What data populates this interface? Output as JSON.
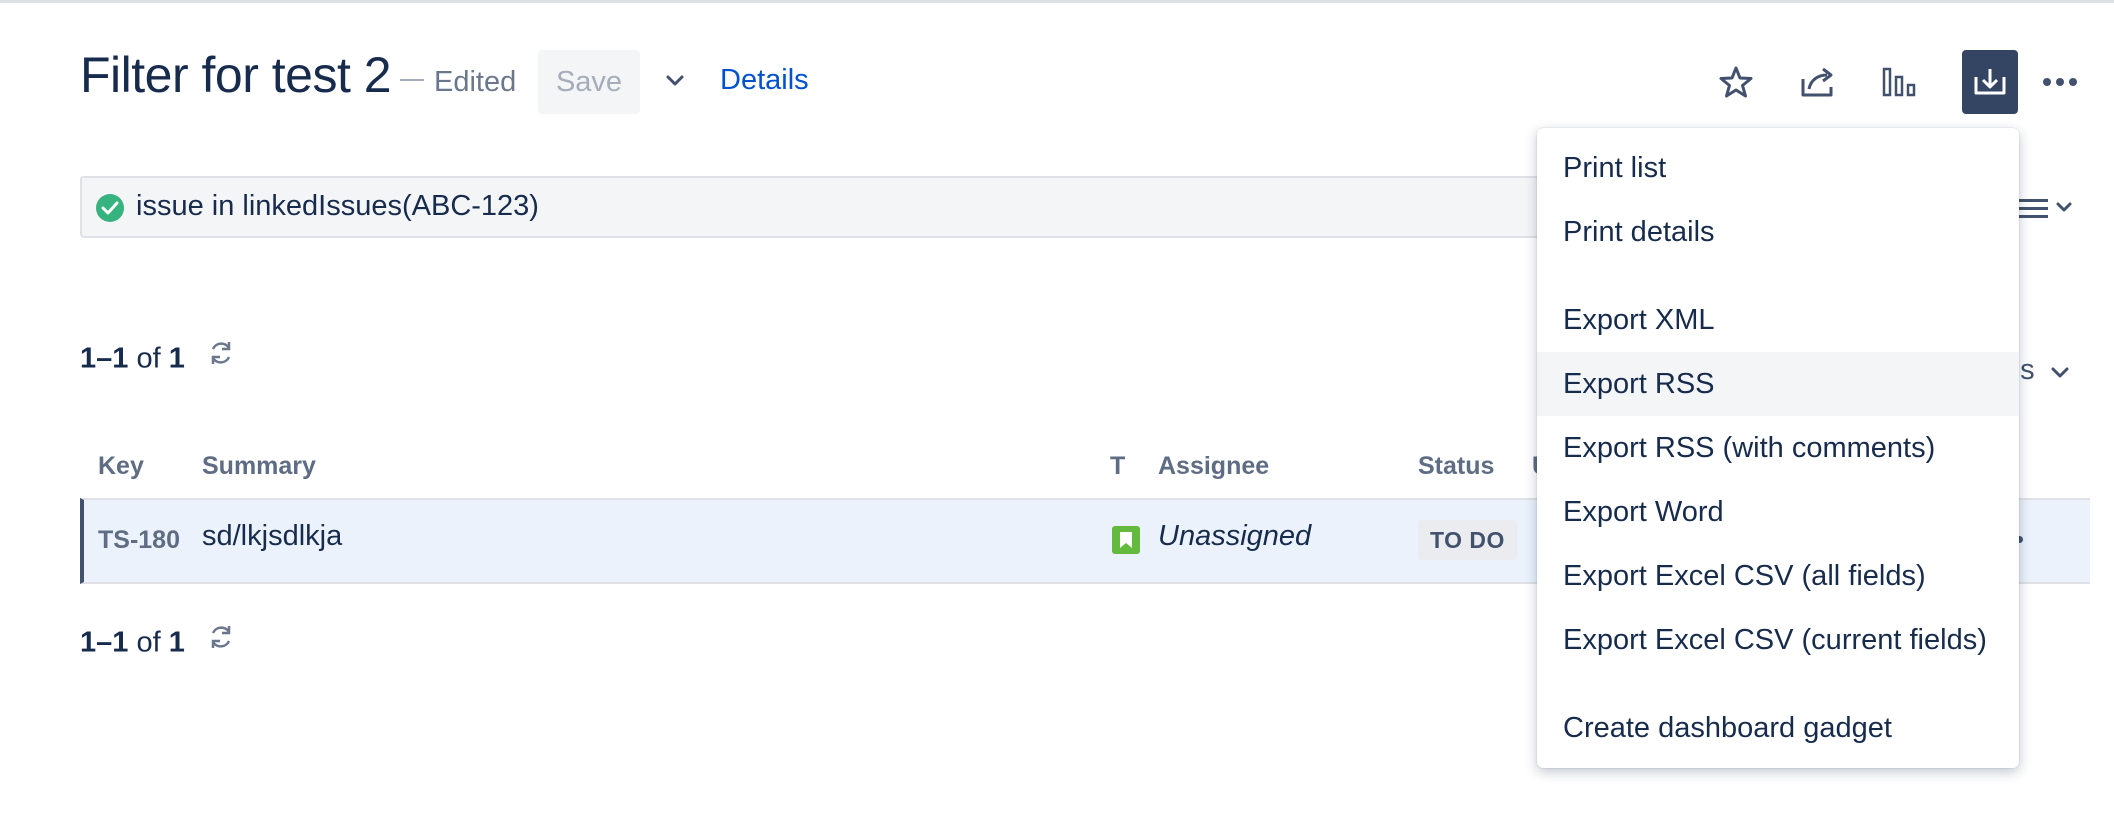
{
  "header": {
    "title": "Filter for test 2",
    "edited_label": "Edited",
    "save_label": "Save",
    "details_label": "Details"
  },
  "toolbar_icons": [
    "star-icon",
    "share-icon",
    "chart-icon",
    "export-icon",
    "more-icon"
  ],
  "search": {
    "query": "issue in linkedIssues(ABC-123)",
    "status": "valid"
  },
  "pagination_top": {
    "range": "1–1",
    "of_label": "of",
    "total": "1"
  },
  "pagination_bottom": {
    "range": "1–1",
    "of_label": "of",
    "total": "1"
  },
  "columns_button_visible_text": "ns",
  "table": {
    "headers": {
      "key": "Key",
      "summary": "Summary",
      "type": "T",
      "assignee": "Assignee",
      "status": "Status",
      "next_partial": "U"
    },
    "rows": [
      {
        "key": "TS-180",
        "summary": "sd/lkjsdlkja",
        "type": "story-icon",
        "assignee": "Unassigned",
        "status": "TO DO"
      }
    ]
  },
  "export_menu": {
    "items": [
      "Print list",
      "Print details",
      "Export XML",
      "Export RSS",
      "Export RSS (with comments)",
      "Export Word",
      "Export Excel CSV (all fields)",
      "Export Excel CSV (current fields)",
      "Create dashboard gadget"
    ],
    "hovered": "Export RSS"
  },
  "colors": {
    "accent": "#0052CC",
    "active_button": "#344563",
    "success": "#36B37E",
    "story": "#63BA3C",
    "row_highlight": "#EBF2FB"
  }
}
